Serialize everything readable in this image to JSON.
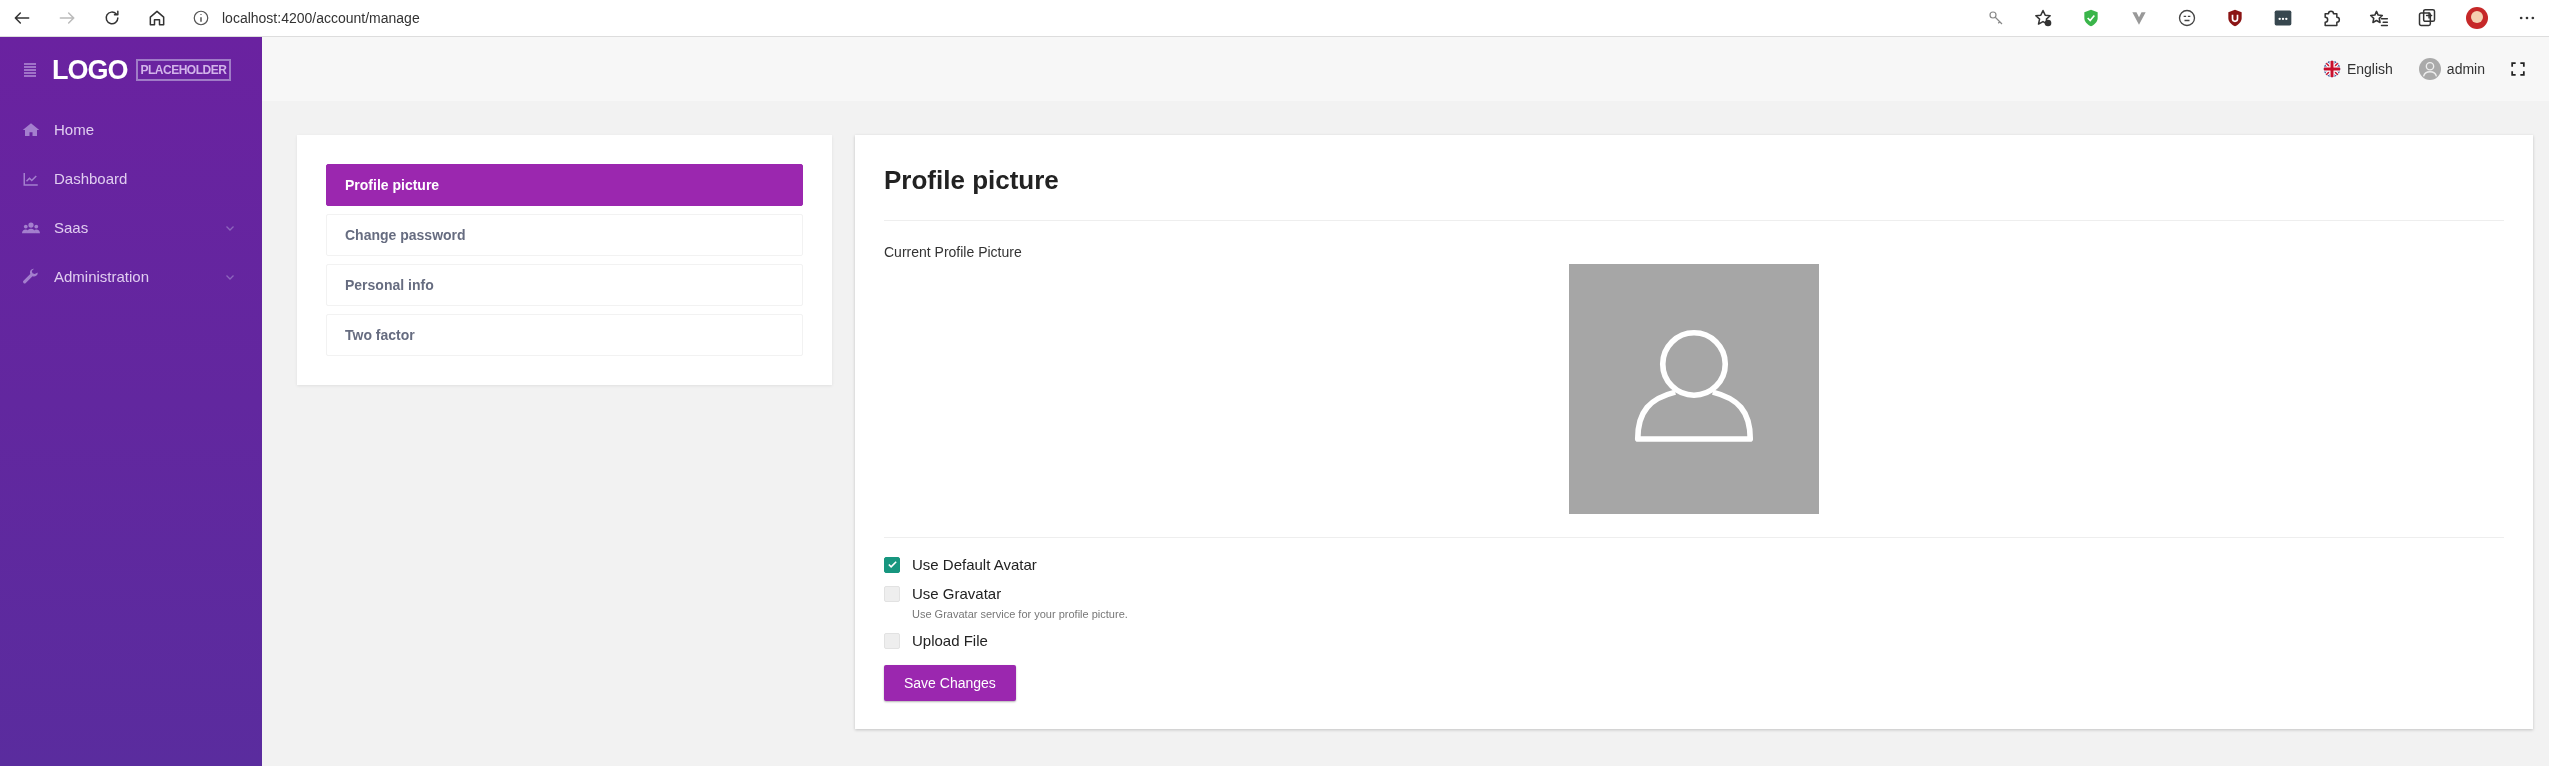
{
  "browser": {
    "url": "localhost:4200/account/manage"
  },
  "sidebar": {
    "logo": "LOGO",
    "logo_tag": "PLACEHOLDER",
    "items": [
      {
        "label": "Home",
        "expandable": false
      },
      {
        "label": "Dashboard",
        "expandable": false
      },
      {
        "label": "Saas",
        "expandable": true
      },
      {
        "label": "Administration",
        "expandable": true
      }
    ]
  },
  "topbar": {
    "language": "English",
    "user": "admin"
  },
  "account_menu": [
    {
      "label": "Profile picture",
      "selected": true
    },
    {
      "label": "Change password",
      "selected": false
    },
    {
      "label": "Personal info",
      "selected": false
    },
    {
      "label": "Two factor",
      "selected": false
    }
  ],
  "panel": {
    "title": "Profile picture",
    "current_label": "Current Profile Picture",
    "options": [
      {
        "label": "Use Default Avatar",
        "checked": true
      },
      {
        "label": "Use Gravatar",
        "checked": false,
        "help": "Use Gravatar service for your profile picture."
      },
      {
        "label": "Upload File",
        "checked": false
      }
    ],
    "save_button": "Save Changes"
  }
}
